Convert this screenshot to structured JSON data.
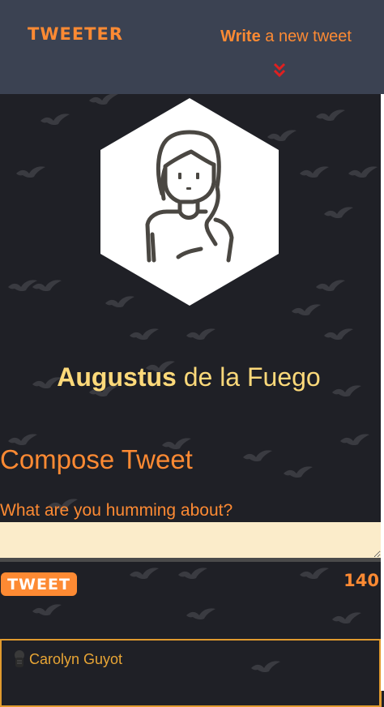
{
  "nav": {
    "brand": "TWEETER",
    "write_strong": "Write",
    "write_rest": " a new tweet",
    "toggle_icon": "double-chevron-down-icon"
  },
  "profile": {
    "avatar_icon": "user-avatar-icon",
    "first_name": "Augustus",
    "last_name": " de la Fuego"
  },
  "compose": {
    "title": "Compose Tweet",
    "label": "What are you humming about?",
    "input_value": "",
    "button_label": "TWEET",
    "counter": "140"
  },
  "tweets": [
    {
      "author": "Carolyn Guyot",
      "avatar_icon": "user-avatar-icon"
    }
  ],
  "colors": {
    "accent": "#fd8a33",
    "name": "#fcd97a",
    "nav_bg": "#3b4252",
    "page_bg": "#1f2026",
    "input_bg": "#fbecca",
    "card_border": "#e09a2e",
    "chevron": "#e02020"
  }
}
